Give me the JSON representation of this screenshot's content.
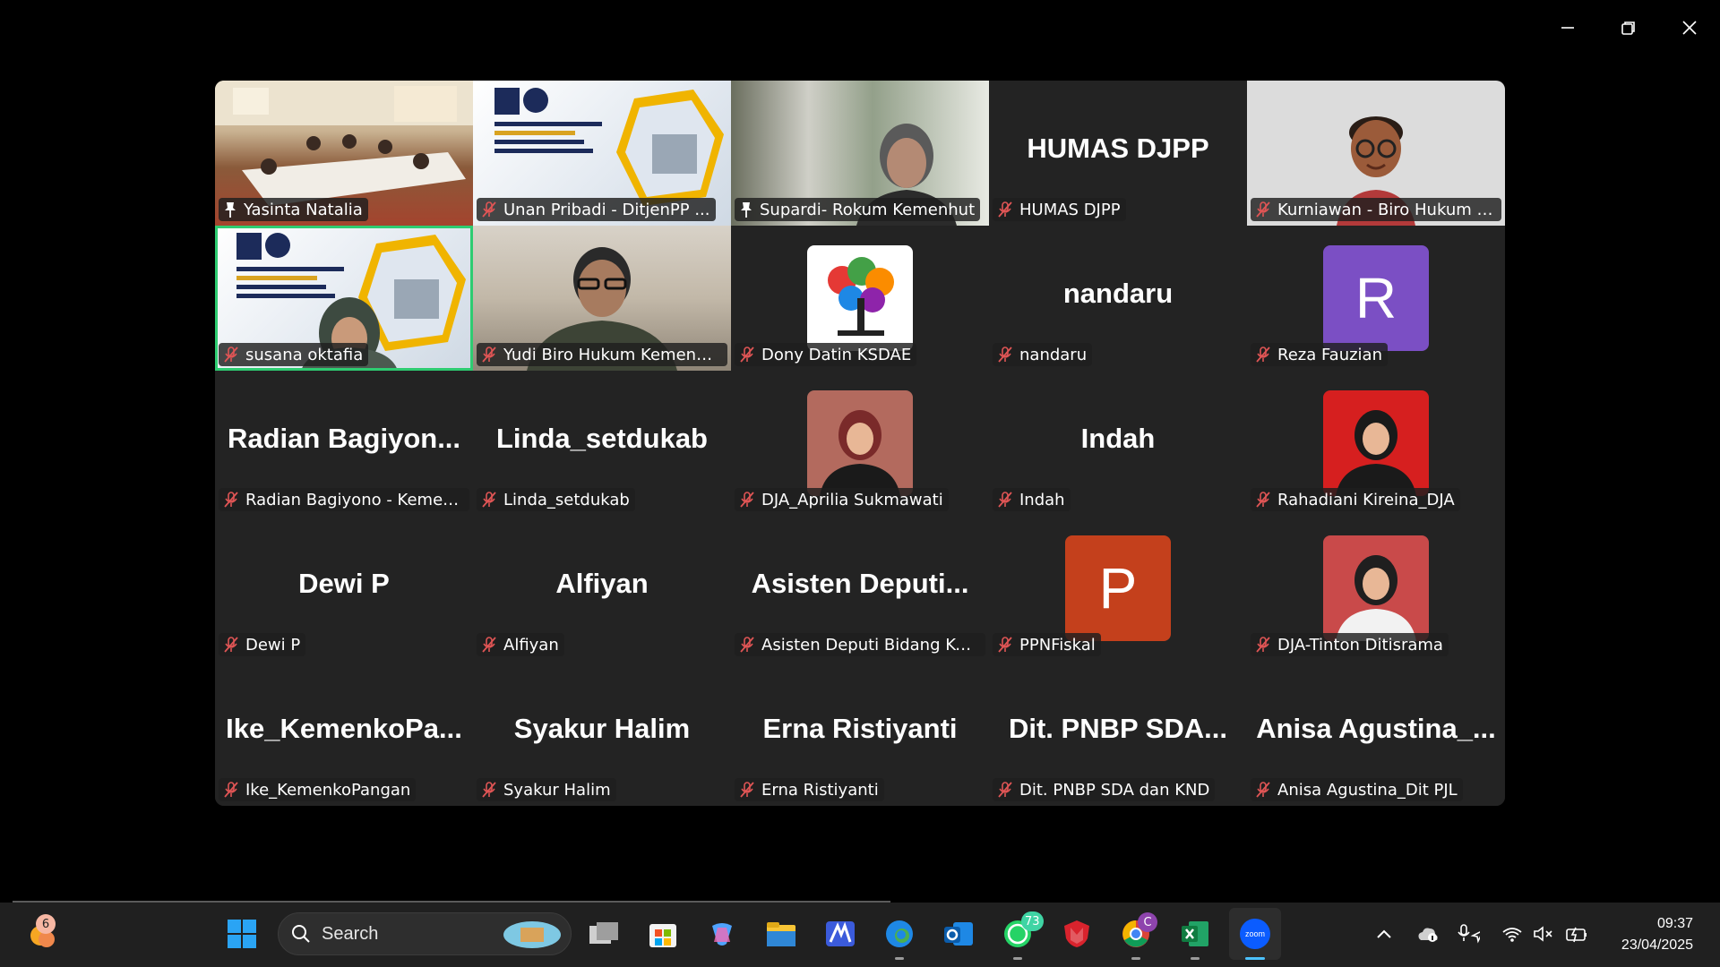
{
  "window": {
    "controls": {
      "minimize_icon": "minimize-icon",
      "restore_icon": "restore-icon",
      "close_icon": "close-icon"
    }
  },
  "gallery": {
    "tiles": [
      {
        "label": "Yasinta Natalia",
        "big": "",
        "mic": "pin",
        "kind": "photo-room"
      },
      {
        "label": "Unan Pribadi - DitjenPP ...",
        "big": "",
        "mic": "muted",
        "kind": "photo-djpp"
      },
      {
        "label": "Supardi- Rokum Kemenhut",
        "big": "",
        "mic": "pin",
        "kind": "photo-blur"
      },
      {
        "label": "HUMAS DJPP",
        "big": "HUMAS DJPP",
        "mic": "muted",
        "kind": "name"
      },
      {
        "label": "Kurniawan - Biro Hukum Ke...",
        "big": "",
        "mic": "muted",
        "kind": "photo-avatar3d"
      },
      {
        "label": "susana oktafia",
        "big": "",
        "mic": "muted",
        "kind": "photo-djpp",
        "active": true
      },
      {
        "label": "Yudi Biro Hukum Kemenhut",
        "big": "",
        "mic": "muted",
        "kind": "photo-office"
      },
      {
        "label": "Dony Datin KSDAE",
        "big": "",
        "mic": "muted",
        "kind": "logo-tree"
      },
      {
        "label": "nandaru",
        "big": "nandaru",
        "mic": "muted",
        "kind": "name"
      },
      {
        "label": "Reza Fauzian",
        "big": "",
        "mic": "muted",
        "kind": "letter",
        "letter": "R",
        "color": "#7b4fc4"
      },
      {
        "label": "Radian Bagiyono - Kemenko...",
        "big": "Radian  Bagiyon...",
        "mic": "muted",
        "kind": "name"
      },
      {
        "label": "Linda_setdukab",
        "big": "Linda_setdukab",
        "mic": "muted",
        "kind": "name"
      },
      {
        "label": "DJA_Aprilia Sukmawati",
        "big": "",
        "mic": "muted",
        "kind": "photo-hijab"
      },
      {
        "label": "Indah",
        "big": "Indah",
        "mic": "muted",
        "kind": "name"
      },
      {
        "label": "Rahadiani Kireina_DJA",
        "big": "",
        "mic": "muted",
        "kind": "photo-red"
      },
      {
        "label": "Dewi P",
        "big": "Dewi P",
        "mic": "muted",
        "kind": "name"
      },
      {
        "label": "Alfiyan",
        "big": "Alfiyan",
        "mic": "muted",
        "kind": "name"
      },
      {
        "label": "Asisten Deputi Bidang Kelau...",
        "big": "Asisten  Deputi...",
        "mic": "muted",
        "kind": "name"
      },
      {
        "label": "PPNFiskal",
        "big": "",
        "mic": "muted",
        "kind": "letter",
        "letter": "P",
        "color": "#c4401c"
      },
      {
        "label": "DJA-Tinton Ditisrama",
        "big": "",
        "mic": "muted",
        "kind": "photo-man"
      },
      {
        "label": "Ike_KemenkoPangan",
        "big": "Ike_KemenkoPa...",
        "mic": "muted",
        "kind": "name"
      },
      {
        "label": "Syakur Halim",
        "big": "Syakur Halim",
        "mic": "muted",
        "kind": "name"
      },
      {
        "label": "Erna Ristiyanti",
        "big": "Erna Ristiyanti",
        "mic": "muted",
        "kind": "name"
      },
      {
        "label": "Dit. PNBP SDA dan KND",
        "big": "Dit.  PNBP SDA...",
        "mic": "muted",
        "kind": "name"
      },
      {
        "label": "Anisa Agustina_Dit PJL",
        "big": "Anisa  Agustina_...",
        "mic": "muted",
        "kind": "name"
      }
    ]
  },
  "taskbar": {
    "weather_badge": "6",
    "search_label": "Search",
    "whatsapp_badge": "73",
    "chrome_badge": "C",
    "clock_time": "09:37",
    "clock_date": "23/04/2025",
    "zoom_label": "zoom"
  },
  "colors": {
    "accent_active": "#2ecc71",
    "muted_mic": "#e05555",
    "taskbar_bg": "#202020"
  }
}
